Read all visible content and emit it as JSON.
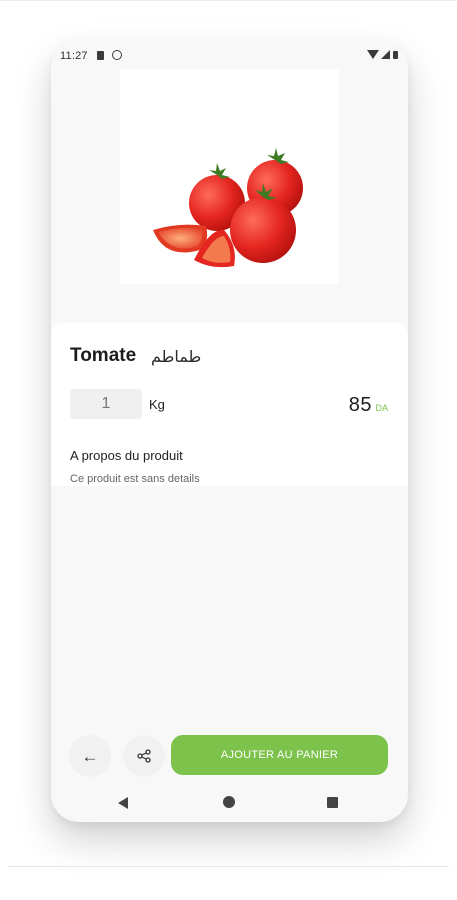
{
  "status_bar": {
    "time": "11:27",
    "icons": [
      "sd-card-icon",
      "do-not-disturb-icon",
      "wifi-icon",
      "signal-icon",
      "battery-icon"
    ]
  },
  "product": {
    "image_icon": "tomatoes-photo",
    "name": "Tomate",
    "name_arabic": "طماطم",
    "quantity": "1",
    "unit": "Kg",
    "price": "85",
    "currency": "DA",
    "about_heading": "A propos du produit",
    "about_text": "Ce produit est sans details"
  },
  "actions": {
    "back_icon": "arrow-left-icon",
    "share_icon": "share-icon",
    "add_to_cart_label": "AJOUTER AU PANIER"
  },
  "nav_bar": {
    "icons": [
      "nav-back-icon",
      "nav-home-icon",
      "nav-recent-icon"
    ]
  },
  "colors": {
    "accent": "#7dc24b",
    "card": "#ffffff",
    "screen": "#f8f8f8",
    "button_bg": "#f1f1f1"
  }
}
